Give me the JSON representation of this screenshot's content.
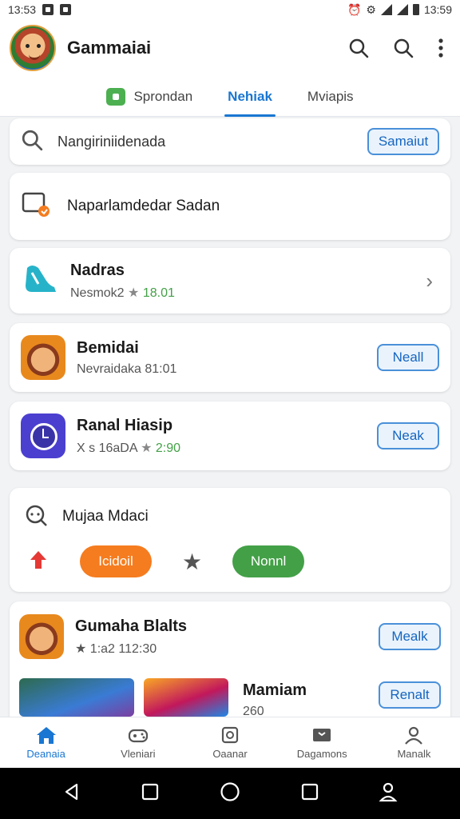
{
  "status_bar": {
    "time_left": "13:53",
    "time_right": "13:59"
  },
  "header": {
    "title": "Gammaiai"
  },
  "tabs": [
    {
      "label": "Sprondan"
    },
    {
      "label": "Nehiak"
    },
    {
      "label": "Mviapis"
    }
  ],
  "search": {
    "value": "Nangiriniidenada",
    "button": "Samaiut"
  },
  "banner": {
    "text": "Naparlamdedar Sadan"
  },
  "list": [
    {
      "name": "Nadras",
      "sub": "Nesmok2",
      "rating": "18.01",
      "icon": "car-seat-icon"
    },
    {
      "name": "Bemidai",
      "sub": "Nevraidaka 81:01",
      "action": "Neall",
      "icon": "game-face-icon"
    },
    {
      "name": "Ranal Hiasip",
      "sub": "X s 16aDA",
      "rating": "2:90",
      "action": "Neak",
      "icon": "clock-icon"
    }
  ],
  "filter_card": {
    "label": "Mujaa Mdaci",
    "chips": [
      {
        "label": "Icidoil",
        "color": "#f57c1f"
      },
      {
        "label": "Nonnl",
        "color": "#43a047"
      }
    ]
  },
  "featured": {
    "name": "Gumaha Blalts",
    "sub": "★ 1:a2 112:30",
    "action": "Mealk"
  },
  "promo": {
    "name": "Mamiam",
    "sub": "260",
    "action": "Renalt"
  },
  "bottom_nav": [
    {
      "label": "Deanaia",
      "active": true
    },
    {
      "label": "Vleniari"
    },
    {
      "label": "Oaanar"
    },
    {
      "label": "Dagamons"
    },
    {
      "label": "Manalk"
    }
  ],
  "colors": {
    "accent": "#1976d2",
    "orange": "#f57c1f",
    "green": "#43a047"
  }
}
